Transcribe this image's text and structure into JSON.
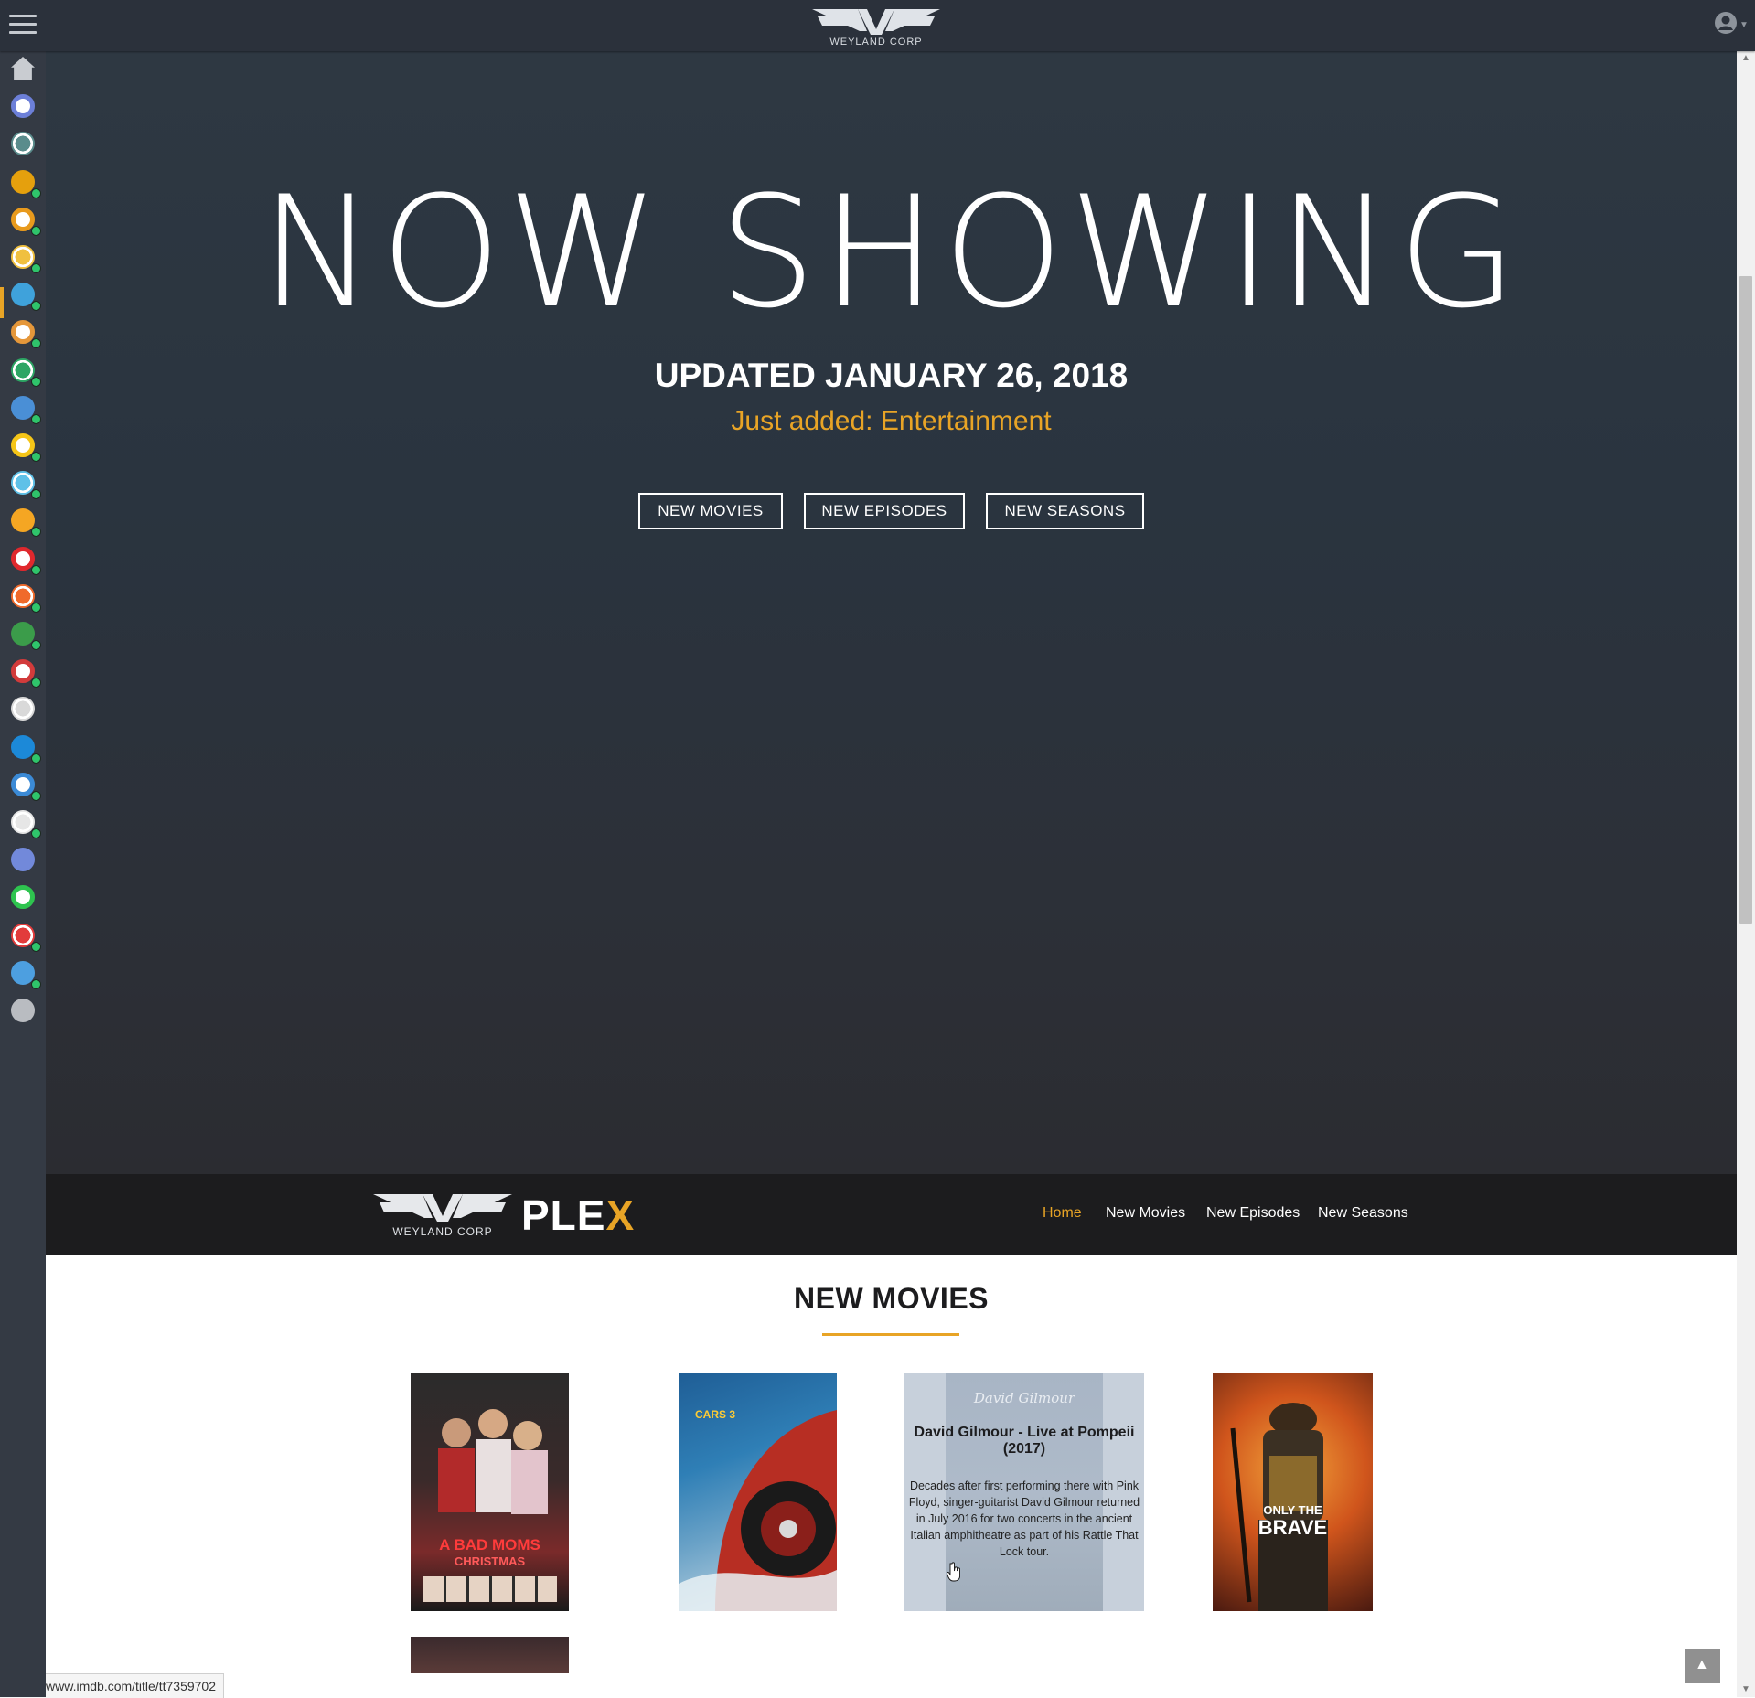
{
  "colors": {
    "accent": "#e8a426",
    "topbar": "#2b313b",
    "sidebar": "#343a44",
    "navbar": "#1c1c1e",
    "status_online": "#2fc46b"
  },
  "topbar": {
    "logo_text": "WEYLAND CORP",
    "menu_icon": "hamburger-icon",
    "user_icon": "user-circle-icon"
  },
  "sidebar": {
    "items": [
      {
        "name": "home",
        "icon": "home-icon",
        "color": "#c9ccd1",
        "status": false
      },
      {
        "name": "organizr",
        "icon": "cube-icon",
        "color": "#6c7fd8",
        "status": false
      },
      {
        "name": "netdata",
        "icon": "globe-icon",
        "color": "#5a8c8c",
        "status": false
      },
      {
        "name": "plex",
        "icon": "plex-chevron-icon",
        "color": "#e5a00d",
        "status": true
      },
      {
        "name": "ombi",
        "icon": "plus-circle-icon",
        "color": "#e89a1d",
        "status": true
      },
      {
        "name": "radarr",
        "icon": "clapperboard-icon",
        "color": "#f0c040",
        "status": true
      },
      {
        "name": "sonarr",
        "icon": "life-ring-icon",
        "color": "#3fa2db",
        "status": true
      },
      {
        "name": "sonarr-4k",
        "icon": "life-ring-orange-icon",
        "color": "#e5973a",
        "status": true
      },
      {
        "name": "tautulli",
        "icon": "refresh-circle-icon",
        "color": "#2da664",
        "status": true
      },
      {
        "name": "deluge",
        "icon": "droplet-icon",
        "color": "#4a8fd6",
        "status": true
      },
      {
        "name": "sabnzbd",
        "icon": "sab-icon",
        "color": "#f5c518",
        "status": true
      },
      {
        "name": "hydra",
        "icon": "network-icon",
        "color": "#5fc1e8",
        "status": true
      },
      {
        "name": "lidarr",
        "icon": "orange-disc-icon",
        "color": "#f5a623",
        "status": true
      },
      {
        "name": "pihole",
        "icon": "shield-icon",
        "color": "#e0282d",
        "status": true
      },
      {
        "name": "grafana",
        "icon": "grafana-icon",
        "color": "#f06a2b",
        "status": true
      },
      {
        "name": "nzbhydra",
        "icon": "nzb-icon",
        "color": "#3b9c4a",
        "status": true
      },
      {
        "name": "couchpotato",
        "icon": "life-ring-red-icon",
        "color": "#d23b3b",
        "status": true
      },
      {
        "name": "jackett",
        "icon": "skull-icon",
        "color": "#d9d9d9",
        "status": false
      },
      {
        "name": "nextcloud",
        "icon": "cloud-icon",
        "color": "#1c89d8",
        "status": true
      },
      {
        "name": "ubooquity",
        "icon": "magnet-icon",
        "color": "#3b8ad6",
        "status": true
      },
      {
        "name": "butler",
        "icon": "butler-icon",
        "color": "#e6e6e6",
        "status": true
      },
      {
        "name": "discord",
        "icon": "discord-icon",
        "color": "#7289da",
        "status": false
      },
      {
        "name": "uptime",
        "icon": "ring-icon",
        "color": "#2ec44f",
        "status": false
      },
      {
        "name": "nzbget",
        "icon": "download-icon",
        "color": "#e23b3b",
        "status": true
      },
      {
        "name": "phpmyadmin",
        "icon": "calendar-icon",
        "color": "#4d9fe0",
        "status": true
      },
      {
        "name": "settings",
        "icon": "gear-icon",
        "color": "#b9bcc1",
        "status": false
      }
    ]
  },
  "hero": {
    "title": "NOW SHOWING",
    "updated": "UPDATED JANUARY 26, 2018",
    "just_added": "Just added: Entertainment",
    "buttons": [
      "NEW MOVIES",
      "NEW EPISODES",
      "NEW SEASONS"
    ]
  },
  "navbar": {
    "logo_text": "WEYLAND CORP",
    "brand": "PLE",
    "brand_x": "X",
    "links": [
      "Home",
      "New Movies",
      "New Episodes",
      "New Seasons"
    ],
    "active": "Home"
  },
  "section": {
    "title": "NEW MOVIES"
  },
  "movies": [
    {
      "poster_text_1": "A BAD MOMS",
      "poster_text_2": "CHRISTMAS",
      "colors": [
        "#2b2b2b",
        "#7a2a2a"
      ]
    },
    {
      "poster_text_1": "CARS 3",
      "poster_text_2": "",
      "colors": [
        "#2c6fa8",
        "#a33a2a"
      ]
    },
    {
      "hover": true,
      "signature": "David Gilmour",
      "title": "David Gilmour - Live at Pompeii (2017)",
      "description": "Decades after first performing there with Pink Floyd, singer-guitarist David Gilmour returned in July 2016 for two concerts in the ancient Italian amphitheatre as part of his Rattle That Lock tour."
    },
    {
      "poster_text_1": "ONLY THE",
      "poster_text_2": "BRAVE",
      "colors": [
        "#c2461a",
        "#2a1a12"
      ]
    }
  ],
  "statusbar": {
    "url": "https://www.imdb.com/title/tt7359702"
  }
}
